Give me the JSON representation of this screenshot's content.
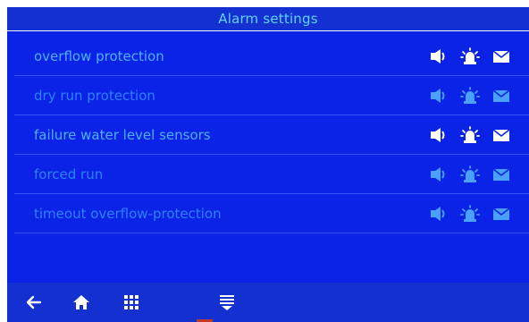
{
  "header": {
    "title": "Alarm settings"
  },
  "alarms": [
    {
      "label": "overflow protection",
      "enabled": true
    },
    {
      "label": "dry run protection",
      "enabled": false
    },
    {
      "label": "failure water level sensors",
      "enabled": true
    },
    {
      "label": "forced run",
      "enabled": false
    },
    {
      "label": "timeout overflow-protection",
      "enabled": false
    }
  ],
  "icons": {
    "horn": "horn-icon",
    "siren": "siren-icon",
    "mail": "mail-icon",
    "back": "back-arrow-icon",
    "home": "home-icon",
    "grid": "grid-menu-icon",
    "list": "list-menu-icon"
  },
  "colors": {
    "background": "#0a23e6",
    "bar": "#1530d0",
    "text_active": "#4fb0ff",
    "text_title": "#5fd4ff",
    "icon_active": "#ffffff",
    "icon_inactive": "#4aa0ff"
  }
}
